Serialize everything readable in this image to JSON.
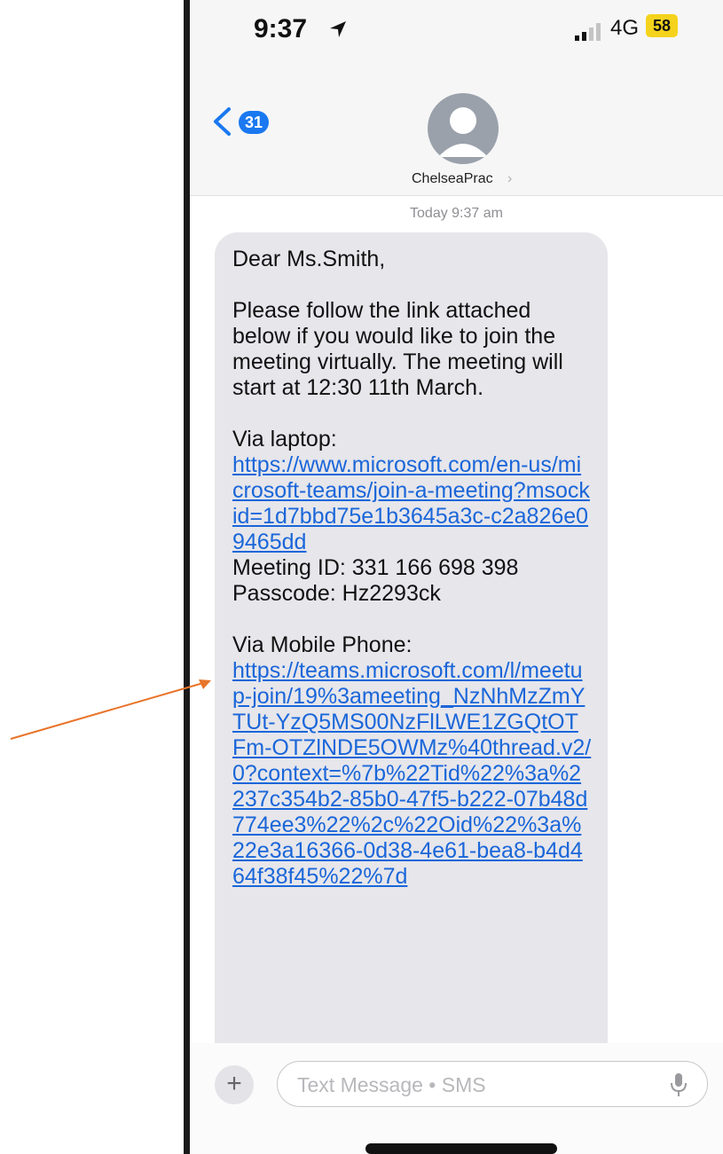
{
  "status_bar": {
    "time": "9:37",
    "network": "4G",
    "battery": "58"
  },
  "nav": {
    "back_badge": "31",
    "contact_name": "ChelseaPrac",
    "chevron": "›"
  },
  "conversation": {
    "timestamp": "Today 9:37 am",
    "message": {
      "greeting": "Dear Ms.Smith,",
      "intro": "Please follow the link attached below if you would like to join the meeting virtually. The meeting will start at 12:30 11th March.",
      "laptop_heading": "Via laptop:",
      "laptop_link": "https://www.microsoft.com/en-us/microsoft-teams/join-a-meeting?msockid=1d7bbd75e1b3645a3c-c2a826e09465dd",
      "meeting_id": "Meeting ID: 331 166 698 398",
      "passcode": "Passcode: Hz2293ck",
      "mobile_heading": "Via Mobile Phone:",
      "mobile_link": "https://teams.microsoft.com/l/meetup-join/19%3ameeting_NzNhMzZmYTUt-YzQ5MS00NzFlLWE1ZGQtOTFm-OTZlNDE5OWMz%40thread.v2/0?context=%7b%22Tid%22%3a%2237c354b2-85b0-47f5-b222-07b48d774ee3%22%2c%22Oid%22%3a%22e3a16366-0d38-4e61-bea8-b4d464f38f45%22%7d"
    }
  },
  "composer": {
    "plus": "+",
    "placeholder": "Text Message • SMS"
  },
  "colors": {
    "link": "#1a66d9",
    "accent": "#1a78f0",
    "bubble": "#e6e6eb",
    "arrow": "#e8742a",
    "battery": "#f5d31c"
  },
  "icons": [
    "location-arrow-icon",
    "signal-icon",
    "back-chevron-icon",
    "avatar-icon",
    "mic-icon"
  ]
}
